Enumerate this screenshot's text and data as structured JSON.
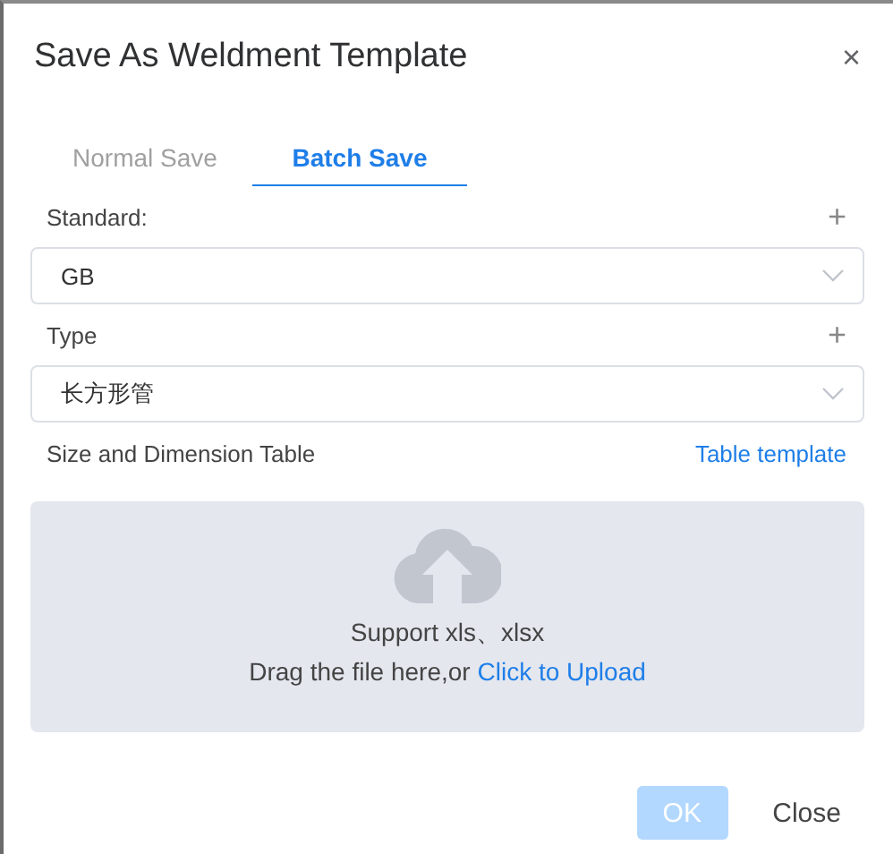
{
  "dialog": {
    "title": "Save As Weldment Template",
    "close": "×"
  },
  "tabs": [
    {
      "label": "Normal Save",
      "selected": false
    },
    {
      "label": "Batch Save",
      "selected": true
    }
  ],
  "fields": [
    {
      "label": "Standard:",
      "add": "+",
      "value": "GB"
    },
    {
      "label": "Type",
      "add": "+",
      "value": "长方形管"
    }
  ],
  "table_section": {
    "label": "Size and Dimension Table",
    "link": "Table template"
  },
  "upload": {
    "hint": "Support xls、xlsx",
    "prompt": "Drag the file here,or",
    "link": "Click to Upload"
  },
  "buttons": [
    {
      "label": "OK",
      "kind": "primary",
      "disabled": true
    },
    {
      "label": "Close",
      "kind": "text",
      "disabled": false
    }
  ]
}
